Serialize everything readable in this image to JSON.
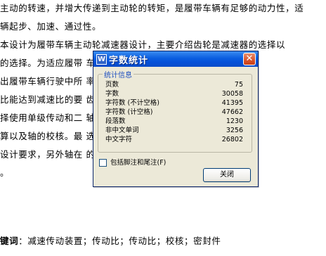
{
  "document": {
    "lines": [
      "主动的转速，并增大传递到主动轮的转矩，是履带车辆有足够的动力性，适",
      "辆起步、加速、通过性。",
      "  本设计为履带车辆主动轮减速器设计，主要介绍齿轮是减速器的选择以",
      "的选择。为适应履带                        车重和最大行驶",
      "出履带车辆行驶中所                         率计算总传动比",
      "比能达到减速比的要                          齿数和尺寸，",
      "择使用单级传动和二                          轴轴颈计算和轴",
      "算以及轴的校核。最                          选择合适的密",
      "设计要求，另外轴在                          的轴应满足技术",
      "。"
    ],
    "keywords_label": "键词",
    "keywords_sep": "：",
    "keywords": "减速传动装置；传动比；传动比；校核；密封件"
  },
  "dialog": {
    "title": "字数统计",
    "title_icon": "W",
    "close_glyph": "✕",
    "group_title": "统计信息",
    "stats": [
      {
        "label": "页数",
        "value": "75"
      },
      {
        "label": "字数",
        "value": "30058"
      },
      {
        "label": "字符数 (不计空格)",
        "value": "41395"
      },
      {
        "label": "字符数 (计空格)",
        "value": "47662"
      },
      {
        "label": "段落数",
        "value": "1230"
      },
      {
        "label": "非中文单词",
        "value": "3256"
      },
      {
        "label": "中文字符",
        "value": "26802"
      }
    ],
    "checkbox_label": "包括脚注和尾注(F)",
    "close_button": "关闭"
  }
}
